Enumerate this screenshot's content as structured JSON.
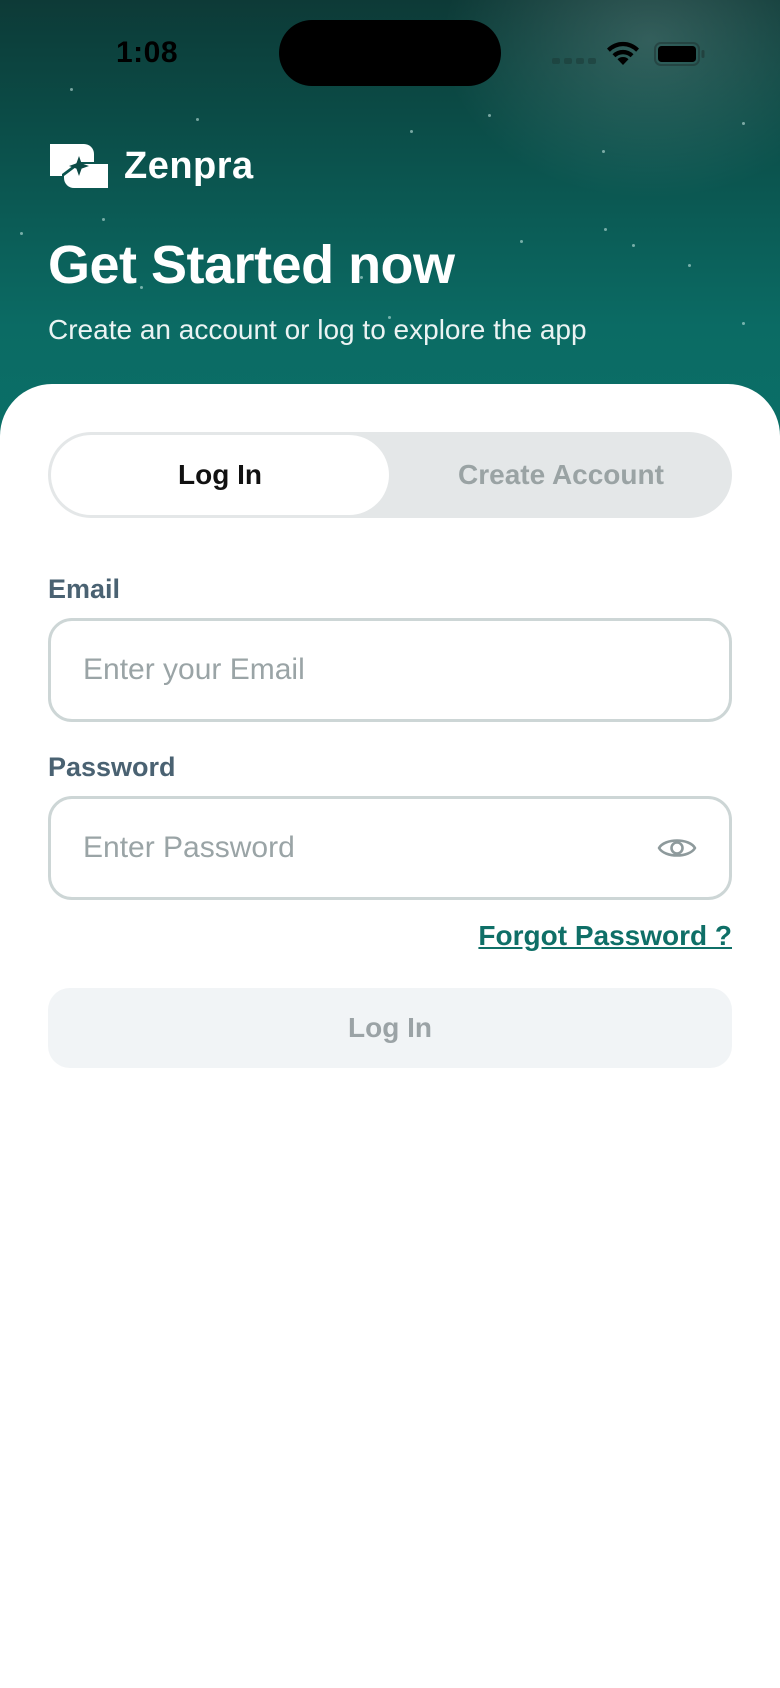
{
  "status_bar": {
    "time": "1:08"
  },
  "brand": {
    "name": "Zenpra",
    "logo_icon": "zenpra-logo-icon"
  },
  "header": {
    "title": "Get Started now",
    "subtitle": "Create an account or log to explore the app"
  },
  "tabs": [
    {
      "label": "Log In",
      "selected": true
    },
    {
      "label": "Create Account",
      "selected": false
    }
  ],
  "form": {
    "email": {
      "label": "Email",
      "placeholder": "Enter your Email",
      "value": ""
    },
    "password": {
      "label": "Password",
      "placeholder": "Enter Password",
      "value": "",
      "toggle_icon": "eye-icon"
    },
    "forgot_password": "Forgot Password ?",
    "submit_label": "Log In"
  },
  "colors": {
    "header_dark": "#0d3a37",
    "header_teal": "#0a7068",
    "accent": "#0f6f67",
    "label": "#4a6272",
    "field_border": "#cdd6d6",
    "disabled_button_bg": "#f1f4f6",
    "disabled_button_text": "#9ba3a6"
  }
}
